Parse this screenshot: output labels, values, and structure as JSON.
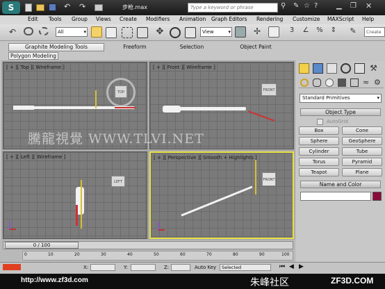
{
  "window": {
    "title": "步枪.max",
    "search_placeholder": "Type a keyword or phrase"
  },
  "menu": [
    "Edit",
    "Tools",
    "Group",
    "Views",
    "Create",
    "Modifiers",
    "Animation",
    "Graph Editors",
    "Rendering",
    "Customize",
    "MAXScript",
    "Help"
  ],
  "toolbar": {
    "selection_filter": "All",
    "ref_coord": "View",
    "create_selection": "Create"
  },
  "ribbon": {
    "tabs": [
      "Graphite Modeling Tools",
      "Freeform",
      "Selection",
      "Object Paint"
    ],
    "subtab": "Polygon Modeling"
  },
  "viewports": {
    "top": "[ + ][ Top ][ Wireframe ]",
    "front": "[ + ][ Front ][ Wireframe ]",
    "left": "[ + ][ Left ][ Wireframe ]",
    "persp": "[ + ][ Perspective ][ Smooth + Highlights ]",
    "viewcube_top": "TOP",
    "viewcube_front": "FRONT",
    "viewcube_left": "LEFT",
    "viewcube_persp": "FRONT"
  },
  "watermark": "騰龍視覺 WWW.TLVI.NET",
  "cmdpanel": {
    "dropdown": "Standard Primitives",
    "object_type_header": "Object Type",
    "autogrid": "AutoGrid",
    "buttons": [
      "Box",
      "Cone",
      "Sphere",
      "GeoSphere",
      "Cylinder",
      "Tube",
      "Torus",
      "Pyramid",
      "Teapot",
      "Plane"
    ],
    "name_color_header": "Name and Color",
    "color": "#8b0a3a"
  },
  "timeline": {
    "frame": "0 / 100",
    "ticks": [
      "0",
      "10",
      "20",
      "30",
      "40",
      "50",
      "60",
      "70",
      "80",
      "90",
      "100"
    ]
  },
  "status": {
    "x": "X:",
    "y": "Y:",
    "z": "Z:",
    "autokey": "Auto Key",
    "selected": "Selected"
  },
  "footer": {
    "url": "http://www.zf3d.com",
    "brand": "朱峰社区",
    "site": "ZF3D.COM"
  }
}
